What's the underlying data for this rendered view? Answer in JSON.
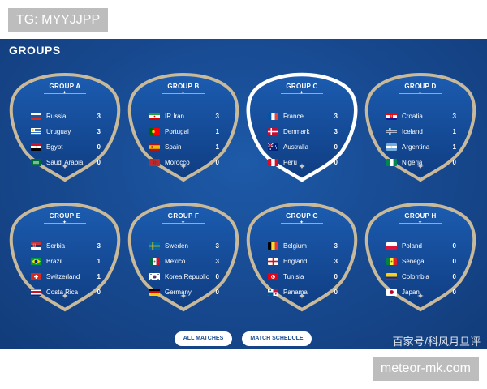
{
  "watermark_top": "TG: MYYJJPP",
  "watermark_bottom": "meteor-mk.com",
  "header": {
    "title": "GROUPS"
  },
  "groups": [
    {
      "title": "GROUP A",
      "highlighted": false,
      "teams": [
        {
          "name": "Russia",
          "points": "3",
          "flag": "russia"
        },
        {
          "name": "Uruguay",
          "points": "3",
          "flag": "uruguay"
        },
        {
          "name": "Egypt",
          "points": "0",
          "flag": "egypt"
        },
        {
          "name": "Saudi Arabia",
          "points": "0",
          "flag": "saudi-arabia"
        }
      ]
    },
    {
      "title": "GROUP B",
      "highlighted": false,
      "teams": [
        {
          "name": "IR Iran",
          "points": "3",
          "flag": "iran"
        },
        {
          "name": "Portugal",
          "points": "1",
          "flag": "portugal"
        },
        {
          "name": "Spain",
          "points": "1",
          "flag": "spain"
        },
        {
          "name": "Morocco",
          "points": "0",
          "flag": "morocco"
        }
      ]
    },
    {
      "title": "GROUP C",
      "highlighted": true,
      "teams": [
        {
          "name": "France",
          "points": "3",
          "flag": "france"
        },
        {
          "name": "Denmark",
          "points": "3",
          "flag": "denmark"
        },
        {
          "name": "Australia",
          "points": "0",
          "flag": "australia"
        },
        {
          "name": "Peru",
          "points": "0",
          "flag": "peru"
        }
      ]
    },
    {
      "title": "GROUP D",
      "highlighted": false,
      "teams": [
        {
          "name": "Croatia",
          "points": "3",
          "flag": "croatia"
        },
        {
          "name": "Iceland",
          "points": "1",
          "flag": "iceland"
        },
        {
          "name": "Argentina",
          "points": "1",
          "flag": "argentina"
        },
        {
          "name": "Nigeria",
          "points": "0",
          "flag": "nigeria"
        }
      ]
    },
    {
      "title": "GROUP E",
      "highlighted": false,
      "teams": [
        {
          "name": "Serbia",
          "points": "3",
          "flag": "serbia"
        },
        {
          "name": "Brazil",
          "points": "1",
          "flag": "brazil"
        },
        {
          "name": "Switzerland",
          "points": "1",
          "flag": "switzerland"
        },
        {
          "name": "Costa Rica",
          "points": "0",
          "flag": "costa-rica"
        }
      ]
    },
    {
      "title": "GROUP F",
      "highlighted": false,
      "teams": [
        {
          "name": "Sweden",
          "points": "3",
          "flag": "sweden"
        },
        {
          "name": "Mexico",
          "points": "3",
          "flag": "mexico"
        },
        {
          "name": "Korea Republic",
          "points": "0",
          "flag": "korea-republic"
        },
        {
          "name": "Germany",
          "points": "0",
          "flag": "germany"
        }
      ]
    },
    {
      "title": "GROUP G",
      "highlighted": false,
      "teams": [
        {
          "name": "Belgium",
          "points": "3",
          "flag": "belgium"
        },
        {
          "name": "England",
          "points": "3",
          "flag": "england"
        },
        {
          "name": "Tunisia",
          "points": "0",
          "flag": "tunisia"
        },
        {
          "name": "Panama",
          "points": "0",
          "flag": "panama"
        }
      ]
    },
    {
      "title": "GROUP H",
      "highlighted": false,
      "teams": [
        {
          "name": "Poland",
          "points": "0",
          "flag": "poland"
        },
        {
          "name": "Senegal",
          "points": "0",
          "flag": "senegal"
        },
        {
          "name": "Colombia",
          "points": "0",
          "flag": "colombia"
        },
        {
          "name": "Japan",
          "points": "0",
          "flag": "japan"
        }
      ]
    }
  ],
  "buttons": {
    "all_matches": "ALL MATCHES",
    "match_schedule": "MATCH SCHEDULE"
  },
  "credit": "百家号/科风月旦评",
  "colors": {
    "background": "#17488e",
    "card_border": "#c7b99a",
    "card_border_active": "#ffffff",
    "text": "#ffffff"
  }
}
